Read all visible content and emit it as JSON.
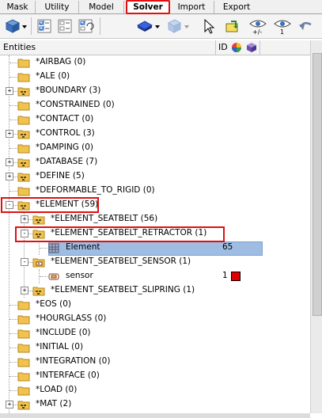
{
  "tabs": [
    {
      "label": "Mask"
    },
    {
      "label": "Utility"
    },
    {
      "label": "Model"
    },
    {
      "label": "Solver"
    },
    {
      "label": "Import"
    },
    {
      "label": "Export"
    }
  ],
  "header": {
    "entities": "Entities",
    "id": "ID"
  },
  "tree": [
    {
      "label": "*AIRBAG (0)"
    },
    {
      "label": "*ALE (0)"
    },
    {
      "label": "*BOUNDARY (3)"
    },
    {
      "label": "*CONSTRAINED (0)"
    },
    {
      "label": "*CONTACT (0)"
    },
    {
      "label": "*CONTROL (3)"
    },
    {
      "label": "*DAMPING (0)"
    },
    {
      "label": "*DATABASE (7)"
    },
    {
      "label": "*DEFINE (5)"
    },
    {
      "label": "*DEFORMABLE_TO_RIGID (0)"
    },
    {
      "label": "*ELEMENT (59)"
    },
    {
      "label": "*ELEMENT_SEATBELT (56)"
    },
    {
      "label": "*ELEMENT_SEATBELT_RETRACTOR (1)"
    },
    {
      "label": "Element",
      "id": "65"
    },
    {
      "label": "*ELEMENT_SEATBELT_SENSOR (1)"
    },
    {
      "label": "sensor",
      "id": "1"
    },
    {
      "label": "*ELEMENT_SEATBELT_SLIPRING (1)"
    },
    {
      "label": "*EOS (0)"
    },
    {
      "label": "*HOURGLASS (0)"
    },
    {
      "label": "*INCLUDE (0)"
    },
    {
      "label": "*INITIAL (0)"
    },
    {
      "label": "*INTEGRATION (0)"
    },
    {
      "label": "*INTERFACE (0)"
    },
    {
      "label": "*LOAD (0)"
    },
    {
      "label": "*MAT (2)"
    }
  ],
  "colors": {
    "highlight": "#e01010",
    "selection": "#9fbde3",
    "sensor_swatch": "#e00000",
    "folder": "#f2c24e"
  }
}
